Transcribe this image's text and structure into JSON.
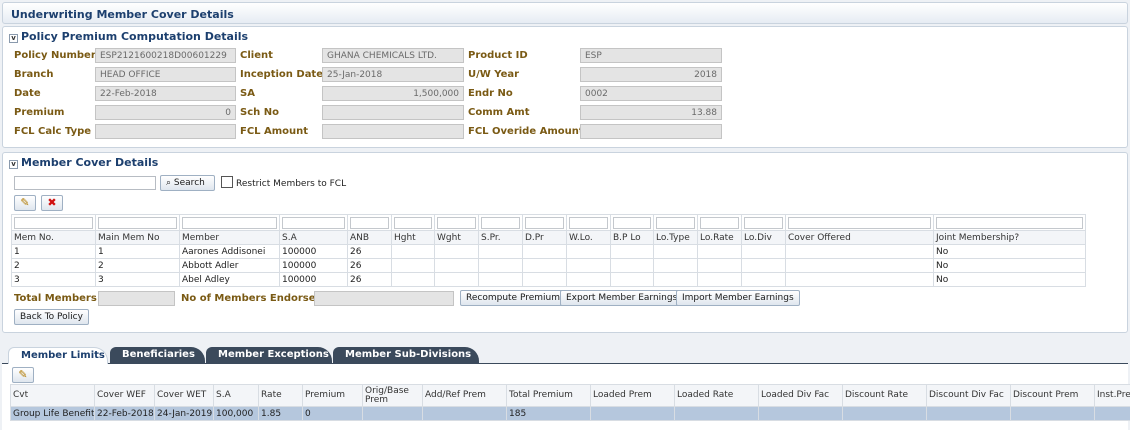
{
  "page": {
    "title": "Underwriting Member Cover Details"
  },
  "policy": {
    "heading": "Policy Premium Computation Details",
    "fields": {
      "policy_number": {
        "label": "Policy Number",
        "value": "ESP2121600218D00601229"
      },
      "client": {
        "label": "Client",
        "value": "GHANA CHEMICALS LTD."
      },
      "product_id": {
        "label": "Product ID",
        "value": "ESP"
      },
      "branch": {
        "label": "Branch",
        "value": "HEAD OFFICE"
      },
      "inception_date": {
        "label": "Inception Date",
        "value": "25-Jan-2018"
      },
      "uw_year": {
        "label": "U/W Year",
        "value": "2018"
      },
      "date": {
        "label": "Date",
        "value": "22-Feb-2018"
      },
      "sa": {
        "label": "SA",
        "value": "1,500,000"
      },
      "endr_no": {
        "label": "Endr No",
        "value": "0002"
      },
      "premium": {
        "label": "Premium",
        "value": "0"
      },
      "sch_no": {
        "label": "Sch No",
        "value": ""
      },
      "comm_amt": {
        "label": "Comm Amt",
        "value": "13.88"
      },
      "fcl_calc_type": {
        "label": "FCL Calc Type",
        "value": ""
      },
      "fcl_amount": {
        "label": "FCL Amount",
        "value": ""
      },
      "fcl_override_amount": {
        "label": "FCL Overide Amount",
        "value": ""
      }
    }
  },
  "members": {
    "heading": "Member Cover Details",
    "search": {
      "value": "",
      "button": "Search",
      "restrict_label": "Restrict Members to FCL"
    },
    "columns": [
      "Mem No.",
      "Main Mem No",
      "Member",
      "S.A",
      "ANB",
      "Hght",
      "Wght",
      "S.Pr.",
      "D.Pr",
      "W.Lo.",
      "B.P Lo",
      "Lo.Type",
      "Lo.Rate",
      "Lo.Div",
      "Cover Offered",
      "Joint Membership?"
    ],
    "rows": [
      [
        "1",
        "1",
        "Aarones Addisonei",
        "100000",
        "26",
        "",
        "",
        "",
        "",
        "",
        "",
        "",
        "",
        "",
        "",
        "No"
      ],
      [
        "2",
        "2",
        "Abbott Adler",
        "100000",
        "26",
        "",
        "",
        "",
        "",
        "",
        "",
        "",
        "",
        "",
        "",
        "No"
      ],
      [
        "3",
        "3",
        "Abel Adley",
        "100000",
        "26",
        "",
        "",
        "",
        "",
        "",
        "",
        "",
        "",
        "",
        "",
        "No"
      ]
    ],
    "total_members_label": "Total Members",
    "total_members_value": "",
    "endorsed_label": "No of Members Endorsed",
    "endorsed_value": "",
    "recompute_button": "Recompute Premium",
    "export_button": "Export Member Earnings",
    "import_button": "Import Member Earnings",
    "back_button": "Back To Policy"
  },
  "tabs": [
    "Member Limits",
    "Beneficiaries",
    "Member Exceptions",
    "Member Sub-Divisions"
  ],
  "limits": {
    "columns": [
      "Cvt",
      "Cover WEF",
      "Cover WET",
      "S.A",
      "Rate",
      "Premium",
      "Orig/Base Prem",
      "Add/Ref Prem",
      "Total Premium",
      "Loaded Prem",
      "Loaded Rate",
      "Loaded Div Fac",
      "Discount Rate",
      "Discount Div Fac",
      "Discount Prem",
      "Inst.Pre"
    ],
    "rows": [
      [
        "Group Life Benefit",
        "22-Feb-2018",
        "24-Jan-2019",
        "100,000",
        "1.85",
        "0",
        "",
        "",
        "185",
        "",
        "",
        "",
        "",
        "",
        "",
        ""
      ]
    ]
  },
  "colors": {
    "accent": "#1c3f6e",
    "label": "#7a5a14",
    "selected_row": "#b5c7dd",
    "tab_dark": "#3b4a5c"
  }
}
